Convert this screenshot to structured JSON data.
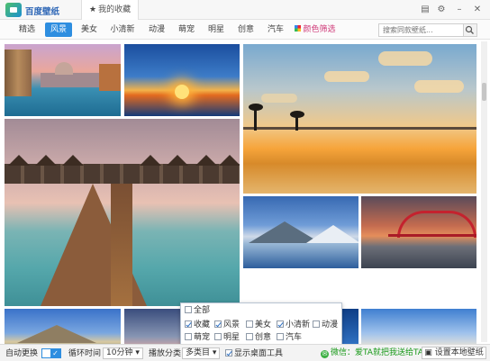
{
  "titlebar": {
    "app_name": "百度壁纸",
    "favorites_tab": "我的收藏"
  },
  "nav": {
    "items": [
      "精选",
      "风景",
      "美女",
      "小清新",
      "动漫",
      "萌宠",
      "明星",
      "创意",
      "汽车"
    ],
    "active_index": 1,
    "color_filter_label": "颜色筛选",
    "search_placeholder": "搜索同款壁纸..."
  },
  "category_popup": {
    "select_all": {
      "label": "全部",
      "checked": false
    },
    "options": [
      {
        "label": "收藏",
        "checked": true
      },
      {
        "label": "风景",
        "checked": true
      },
      {
        "label": "美女",
        "checked": false
      },
      {
        "label": "小清新",
        "checked": true
      },
      {
        "label": "动漫",
        "checked": false
      },
      {
        "label": "萌宠",
        "checked": false
      },
      {
        "label": "明星",
        "checked": false
      },
      {
        "label": "创意",
        "checked": false
      },
      {
        "label": "汽车",
        "checked": false
      }
    ]
  },
  "bottombar": {
    "auto_change_label": "自动更换",
    "cycle_time_label": "循环时间",
    "cycle_time_value": "10分钟",
    "play_category_label": "播放分类",
    "category_value": "多类目",
    "show_desktop_tool_label": "显示桌面工具",
    "promo_text": "微信：爱TA就把我送给TA！",
    "set_local_wallpaper": "设置本地壁纸"
  },
  "colors": {
    "accent": "#2e8ee0",
    "promo_green": "#1a9a1a"
  }
}
